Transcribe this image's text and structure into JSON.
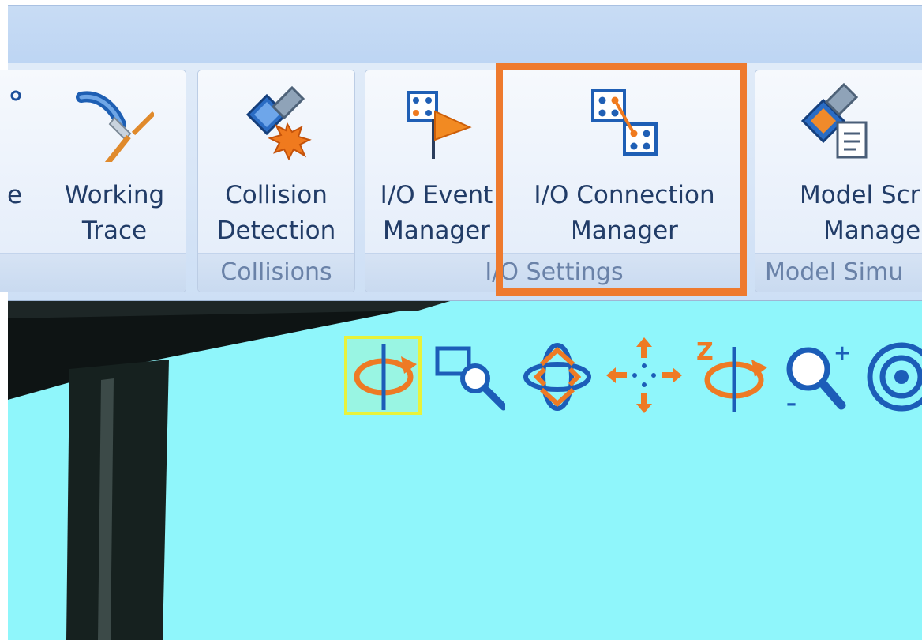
{
  "ribbon": {
    "left_partial_label": "e",
    "buttons": {
      "working_trace": {
        "line1": "Working",
        "line2": "Trace"
      },
      "collision_detection": {
        "line1": "Collision",
        "line2": "Detection"
      },
      "io_event_manager": {
        "line1": "I/O Event",
        "line2": "Manager"
      },
      "io_connection_manager": {
        "line1": "I/O Connection",
        "line2": "Manager"
      },
      "model_script_manager": {
        "line1": "Model Scr",
        "line2": "Manage"
      }
    },
    "groups": {
      "collisions": "Collisions",
      "io_settings": "I/O Settings",
      "model_simulation": "Model Simu"
    }
  },
  "view_toolbar": {
    "tools": [
      "orbit-icon",
      "zoom-window-icon",
      "free-rotate-icon",
      "pan-icon",
      "z-rotate-icon",
      "zoom-in-out-icon",
      "target-icon"
    ],
    "selected": "orbit-icon",
    "z_axis_letter": "Z",
    "zoom_plus": "+",
    "zoom_minus": "–"
  },
  "colors": {
    "ribbon_text": "#213c67",
    "group_label_text": "#6a82a8",
    "viewport_background": "#8ff6fb",
    "highlight": "#ee7a2e",
    "selected_tool_border": "#e8f23a",
    "tool_orange": "#ee7a24",
    "tool_blue": "#1c5db8"
  }
}
